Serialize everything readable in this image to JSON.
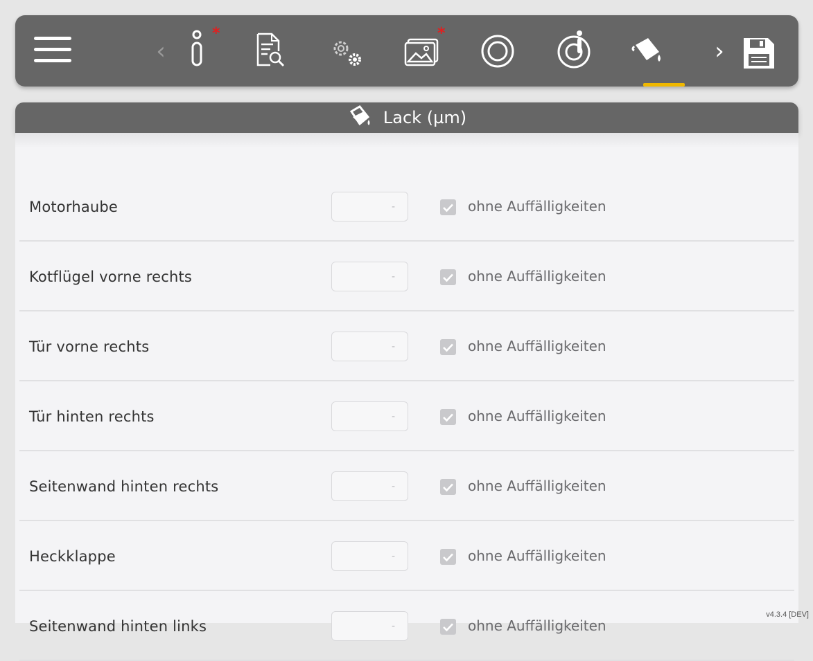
{
  "toolbar": {
    "menu_icon": "hamburger-menu-icon",
    "prev_arrow": "‹",
    "next_arrow": "›",
    "required_marker": "*",
    "icons": [
      "info-icon",
      "document-search-icon",
      "settings-gears-icon",
      "images-icon",
      "tire-icon",
      "wheel-info-icon",
      "paint-bucket-icon"
    ],
    "save_icon": "floppy-disk-save-icon",
    "active_tab": "paint-bucket-icon",
    "accent_color": "#f0b800",
    "bar_color": "#666666"
  },
  "section": {
    "icon": "paint-bucket-icon",
    "title": "Lack (µm)"
  },
  "rows": [
    {
      "label": "Motorhaube",
      "value": "-",
      "checked": true,
      "check_label": "ohne Auffälligkeiten"
    },
    {
      "label": "Kotflügel vorne rechts",
      "value": "-",
      "checked": true,
      "check_label": "ohne Auffälligkeiten"
    },
    {
      "label": "Tür vorne rechts",
      "value": "-",
      "checked": true,
      "check_label": "ohne Auffälligkeiten"
    },
    {
      "label": "Tür hinten rechts",
      "value": "-",
      "checked": true,
      "check_label": "ohne Auffälligkeiten"
    },
    {
      "label": "Seitenwand hinten rechts",
      "value": "-",
      "checked": true,
      "check_label": "ohne Auffälligkeiten"
    },
    {
      "label": "Heckklappe",
      "value": "-",
      "checked": true,
      "check_label": "ohne Auffälligkeiten"
    },
    {
      "label": "Seitenwand hinten links",
      "value": "-",
      "checked": true,
      "check_label": "ohne Auffälligkeiten"
    }
  ],
  "version": "v4.3.4 [DEV]"
}
